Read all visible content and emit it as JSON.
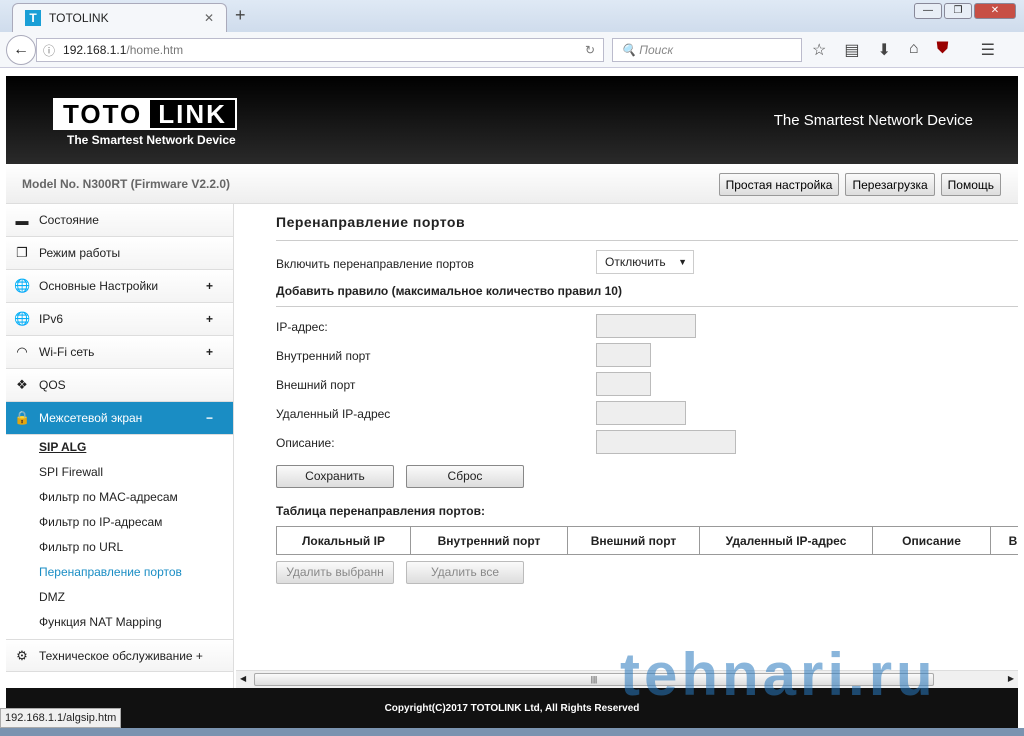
{
  "browser": {
    "tab_title": "TOTOLINK",
    "url_host": "192.168.1.1",
    "url_path": "/home.htm",
    "search_placeholder": "Поиск",
    "status_url": "192.168.1.1/algsip.htm"
  },
  "header": {
    "logo_left": "TOTO",
    "logo_right": "LINK",
    "slogan": "The Smartest Network Device",
    "slogan_right": "The Smartest Network Device",
    "model": "Model No. N300RT (Firmware V2.2.0)",
    "buttons": [
      "Простая настройка",
      "Перезагрузка",
      "Помощь"
    ]
  },
  "sidebar": {
    "items": [
      {
        "label": "Состояние",
        "icon": "chat-icon",
        "plus": ""
      },
      {
        "label": "Режим работы",
        "icon": "windows-icon",
        "plus": ""
      },
      {
        "label": "Основные Настройки",
        "icon": "globe-icon",
        "plus": "+"
      },
      {
        "label": "IPv6",
        "icon": "globe-icon",
        "plus": "+"
      },
      {
        "label": "Wi-Fi сеть",
        "icon": "wifi-icon",
        "plus": "+"
      },
      {
        "label": "QOS",
        "icon": "qos-icon",
        "plus": ""
      },
      {
        "label": "Межсетевой экран",
        "icon": "lock-icon",
        "plus": "−"
      }
    ],
    "subitems": [
      "SIP ALG",
      "SPI Firewall",
      "Фильтр по MAC-адресам",
      "Фильтр по IP-адресам",
      "Фильтр по URL",
      "Перенаправление портов",
      "DMZ",
      "Функция NAT Mapping"
    ],
    "maintenance": {
      "label": "Техническое обслуживание +",
      "icon": "gear-icon"
    }
  },
  "main": {
    "title": "Перенаправление портов",
    "enable_label": "Включить перенаправление портов",
    "enable_value": "Отключить",
    "add_rule": "Добавить правило (максимальное количество правил 10)",
    "fields": [
      "IP-адрес:",
      "Внутренний порт",
      "Внешний порт",
      "Удаленный IP-адрес",
      "Описание:"
    ],
    "save": "Сохранить",
    "reset": "Сброс",
    "table_title": "Таблица перенаправления портов:",
    "columns": [
      "Локальный IP",
      "Внутренний порт",
      "Внешний порт",
      "Удаленный IP-адрес",
      "Описание",
      "В"
    ],
    "delete_selected": "Удалить выбранн",
    "delete_all": "Удалить все"
  },
  "footer": {
    "copyright": "Copyright(C)2017 TOTOLINK Ltd, All Rights Reserved"
  },
  "watermark": "tehnari.ru",
  "colors": {
    "accent": "#1a8dc4"
  }
}
